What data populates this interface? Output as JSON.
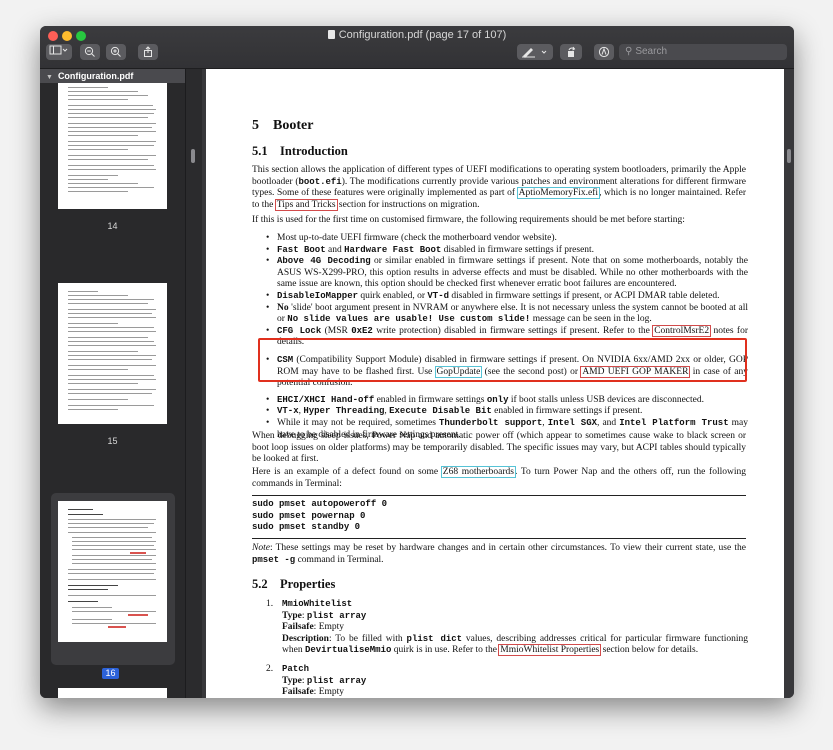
{
  "window": {
    "title": "Configuration.pdf (page 17 of 107)",
    "search_placeholder": "Search"
  },
  "toolbar": {
    "sidebar_toggle": "sidebar-icon",
    "zoom_out": "zoom-out-icon",
    "zoom_in": "zoom-in-icon",
    "share": "share-icon",
    "markup": "pen-icon",
    "rotate": "rotate-icon",
    "annotate": "markup-circle-icon"
  },
  "sidebar": {
    "header": "Configuration.pdf",
    "pages": [
      {
        "number": "14",
        "selected": false
      },
      {
        "number": "15",
        "selected": false
      },
      {
        "number": "16",
        "selected": true
      }
    ]
  },
  "page": {
    "heading1": {
      "num": "5",
      "text": "Booter"
    },
    "section51": {
      "num": "5.1",
      "text": "Introduction"
    },
    "intro": {
      "p1": "This section allows the application of different types of UEFI modifications to operating system bootloaders, primarily the Apple bootloader (",
      "p1_code": "boot.efi",
      "p2": "). The modifications currently provide various patches and environment alterations for different firmware types. Some of these features were originally implemented as part of ",
      "p2_link": "AptioMemoryFix.efi",
      "p3": ", which is no longer maintained. Refer to the ",
      "p3_link": "Tips and Tricks",
      "p4": " section for instructions on migration."
    },
    "requirements_intro": "If this is used for the first time on customised firmware, the following requirements should be met before starting:",
    "bullets": {
      "b1": "Most up-to-date UEFI firmware (check the motherboard vendor website).",
      "b2_code1": "Fast Boot",
      "b2_and": " and ",
      "b2_code2": "Hardware Fast Boot",
      "b2_rest": " disabled in firmware settings if present.",
      "b3_code": "Above 4G Decoding",
      "b3_rest": " or similar enabled in firmware settings if present. Note that on some motherboards, notably the ASUS WS-X299-PRO, this option results in adverse effects and must be disabled. While no other motherboards with the same issue are known, this option should be checked first whenever erratic boot failures are encountered.",
      "b4_code1": "DisableIoMapper",
      "b4_mid": " quirk enabled, or ",
      "b4_code2": "VT-d",
      "b4_rest": " disabled in firmware settings if present, or ACPI DMAR table deleted.",
      "b5_no": "No",
      "b5_rest1": " 'slide' boot argument present in NVRAM or anywhere else. It is not necessary unless the system cannot be booted at all or ",
      "b5_code": "No slide values are usable!  Use custom slide!",
      "b5_rest2": " message can be seen in the log.",
      "b6_code1": "CFG Lock",
      "b6_mid": " (MSR ",
      "b6_code2": "0xE2",
      "b6_rest": " write protection) disabled in firmware settings if present. Refer to the ",
      "b6_link": "ControlMsrE2",
      "b6_end": " notes for details.",
      "b7_code": "CSM",
      "b7_rest1": " (Compatibility Support Module) disabled in firmware settings if present. On NVIDIA 6xx/AMD 2xx or older, GOP ROM may have to be flashed first. Use ",
      "b7_link1": "GopUpdate",
      "b7_rest2": " (see the second post) or ",
      "b7_link2": "AMD UEFI GOP MAKER",
      "b7_rest3": " in case of any potential confusion.",
      "b8_code1": "EHCI/XHCI Hand-off",
      "b8_mid": " enabled in firmware settings ",
      "b8_code2": "only",
      "b8_rest": " if boot stalls unless USB devices are disconnected.",
      "b9_code1": "VT-x",
      "b9_c": ", ",
      "b9_code2": "Hyper Threading",
      "b9_c2": ", ",
      "b9_code3": "Execute Disable Bit",
      "b9_rest": " enabled in firmware settings if present.",
      "b10_a": "While it may not be required, sometimes ",
      "b10_code1": "Thunderbolt support",
      "b10_c": ", ",
      "b10_code2": "Intel SGX",
      "b10_and": ", and ",
      "b10_code3": "Intel Platform Trust",
      "b10_rest": " may have to be disabled in firmware settings present."
    },
    "sleep_para": "When debugging sleep issues, Power Nap and automatic power off (which appear to sometimes cause wake to black screen or boot loop issues on older platforms) may be temporarily disabled. The specific issues may vary, but ACPI tables should typically be looked at first.",
    "example": {
      "a": "Here is an example of a defect found on some ",
      "link": "Z68 motherboards",
      "b": ". To turn Power Nap and the others off, run the following commands in Terminal:"
    },
    "commands": [
      "sudo pmset autopoweroff 0",
      "sudo pmset powernap 0",
      "sudo pmset standby 0"
    ],
    "note": {
      "label": "Note",
      "a": ": These settings may be reset by hardware changes and in certain other circumstances. To view their current state, use the ",
      "code": "pmset -g",
      "b": " command in Terminal."
    },
    "section52": {
      "num": "5.2",
      "text": "Properties"
    },
    "props": {
      "p1_num": "1.",
      "p1_name": "MmioWhitelist",
      "type_label": "Type",
      "p1_type": "plist array",
      "failsafe_label": "Failsafe",
      "p1_failsafe": "Empty",
      "desc_label": "Description",
      "p1_desc_a": ": To be filled with ",
      "p1_desc_code": "plist dict",
      "p1_desc_b": " values, describing addresses critical for particular firmware functioning when ",
      "p1_desc_code2": "DevirtualiseMmio",
      "p1_desc_c": " quirk is in use. Refer to the ",
      "p1_desc_link": "MmioWhitelist Properties",
      "p1_desc_d": " section below for details.",
      "p2_num": "2.",
      "p2_name": "Patch",
      "p2_type": "plist array",
      "p2_failsafe": "Empty"
    }
  },
  "colors": {
    "highlight_box": "#e0301e",
    "link_cyan": "#56c3d6",
    "link_red": "#d24b4b",
    "selection_badge": "#2c62d9"
  }
}
